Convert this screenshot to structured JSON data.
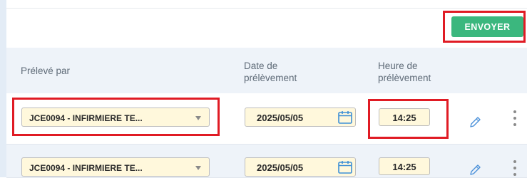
{
  "toolbar": {
    "send_label": "ENVOYER"
  },
  "columns": {
    "collected_by": "Prélevé par",
    "date_line1": "Date de",
    "date_line2": "prélèvement",
    "time_line1": "Heure de",
    "time_line2": "prélèvement"
  },
  "rows": [
    {
      "collected_by": "JCE0094 - INFIRMIERE TE...",
      "date": "2025/05/05",
      "time": "14:25"
    },
    {
      "collected_by": "JCE0094 - INFIRMIERE TE...",
      "date": "2025/05/05",
      "time": "14:25"
    }
  ],
  "colors": {
    "send_button": "#3bb77e",
    "highlight": "#e01b24",
    "field_background": "#fff8dc",
    "header_background": "#eef3f9",
    "calendar_icon": "#3d8fd6"
  },
  "icons": [
    "calendar-icon",
    "pencil-icon",
    "more-vertical-icon",
    "chevron-down-icon"
  ]
}
